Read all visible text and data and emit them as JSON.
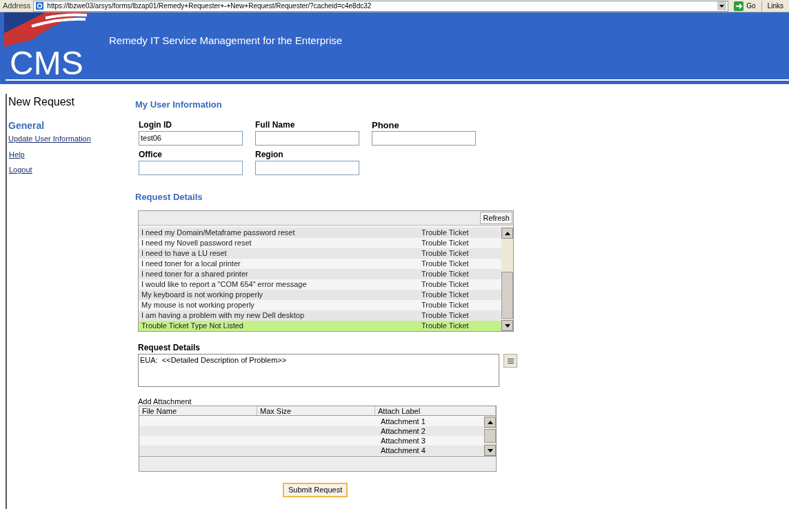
{
  "address_bar": {
    "label": "Address",
    "url": "https://lbzwe03/arsys/forms/lbzap01/Remedy+Requester+-+New+Request/Requester/?cacheid=c4e8dc32",
    "go": "Go",
    "links": "Links"
  },
  "banner": {
    "logo": "CMS",
    "title": "Remedy IT Service Management for the Enterprise"
  },
  "sidebar": {
    "title": "New Request",
    "section": "General",
    "links": [
      "Update User Information",
      "Help",
      "Logout"
    ]
  },
  "user_info": {
    "heading": "My User Information",
    "fields": [
      {
        "label": "Login ID",
        "value": "test06"
      },
      {
        "label": "Full Name"
      },
      {
        "label": "Phone"
      },
      {
        "label": "Office"
      },
      {
        "label": "Region"
      }
    ]
  },
  "request_details": {
    "heading": "Request Details",
    "refresh": "Refresh",
    "rows": [
      {
        "name": "I need my Domain/Metaframe password reset",
        "type": "Trouble Ticket",
        "selected": false
      },
      {
        "name": "I need my Novell password reset",
        "type": "Trouble Ticket",
        "selected": false
      },
      {
        "name": "I need to have a LU reset",
        "type": "Trouble Ticket",
        "selected": false
      },
      {
        "name": "I need toner for a local printer",
        "type": "Trouble Ticket",
        "selected": false
      },
      {
        "name": "I need toner for a shared printer",
        "type": "Trouble Ticket",
        "selected": false
      },
      {
        "name": "I would like to report a \"COM 654\" error message",
        "type": "Trouble Ticket",
        "selected": false
      },
      {
        "name": "My keyboard is not working properly",
        "type": "Trouble Ticket",
        "selected": false
      },
      {
        "name": "My mouse is not working properly",
        "type": "Trouble Ticket",
        "selected": false
      },
      {
        "name": "I am having a problem with my new Dell desktop",
        "type": "Trouble Ticket",
        "selected": false
      },
      {
        "name": "Trouble Ticket Type Not Listed",
        "type": "Trouble Ticket",
        "selected": true
      }
    ]
  },
  "details_field": {
    "label": "Request Details",
    "value": "EUA:  <<Detailed Description of Problem>>"
  },
  "attachments": {
    "label": "Add Attachment",
    "columns": [
      "File Name",
      "Max Size",
      "Attach Label"
    ],
    "rows": [
      "Attachment 1",
      "Attachment 2",
      "Attachment 3",
      "Attachment 4"
    ]
  },
  "submit": "Submit Request"
}
